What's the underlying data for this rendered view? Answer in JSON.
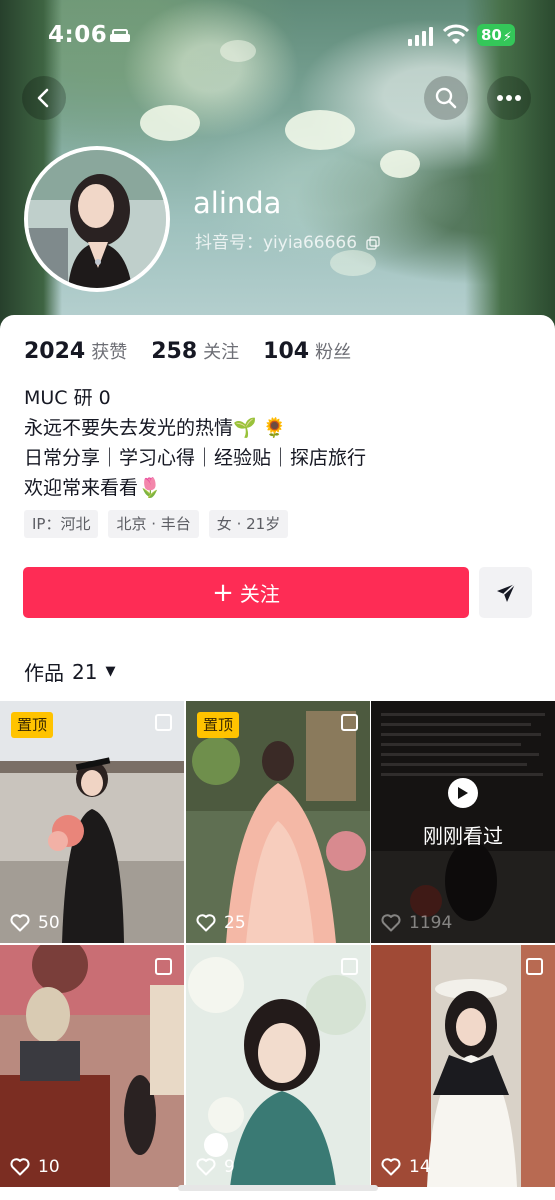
{
  "status_bar": {
    "time": "4:06",
    "battery": "80"
  },
  "profile": {
    "username": "alinda",
    "douyin_id": "抖音号：yiyia66666",
    "stats": [
      {
        "value": "2024",
        "label": "获赞"
      },
      {
        "value": "258",
        "label": "关注"
      },
      {
        "value": "104",
        "label": "粉丝"
      }
    ],
    "bio": [
      "MUC 研 0",
      "永远不要失去发光的热情🌱 🌻",
      "日常分享｜学习心得｜经验贴｜探店旅行",
      "欢迎常来看看🌷"
    ],
    "tags": [
      "IP：河北",
      "北京 · 丰台",
      "女 · 21岁"
    ]
  },
  "actions": {
    "follow_label": "关注",
    "follow_plus": "+"
  },
  "works": {
    "label": "作品",
    "count": "21"
  },
  "grid": [
    {
      "pinned": "置顶",
      "likes": "50"
    },
    {
      "pinned": "置顶",
      "likes": "25"
    },
    {
      "watched": "刚刚看过",
      "likes": "1194"
    },
    {
      "likes": "10"
    },
    {
      "likes": "9"
    },
    {
      "likes": "14"
    }
  ],
  "colors": {
    "accent": "#fe2c55",
    "pin": "#ffc300",
    "battery": "#34c759"
  },
  "icons": [
    "back-icon",
    "search-icon",
    "more-icon",
    "copy-icon",
    "send-icon",
    "heart-icon",
    "play-icon",
    "multi-image-icon",
    "caret-down-icon"
  ]
}
